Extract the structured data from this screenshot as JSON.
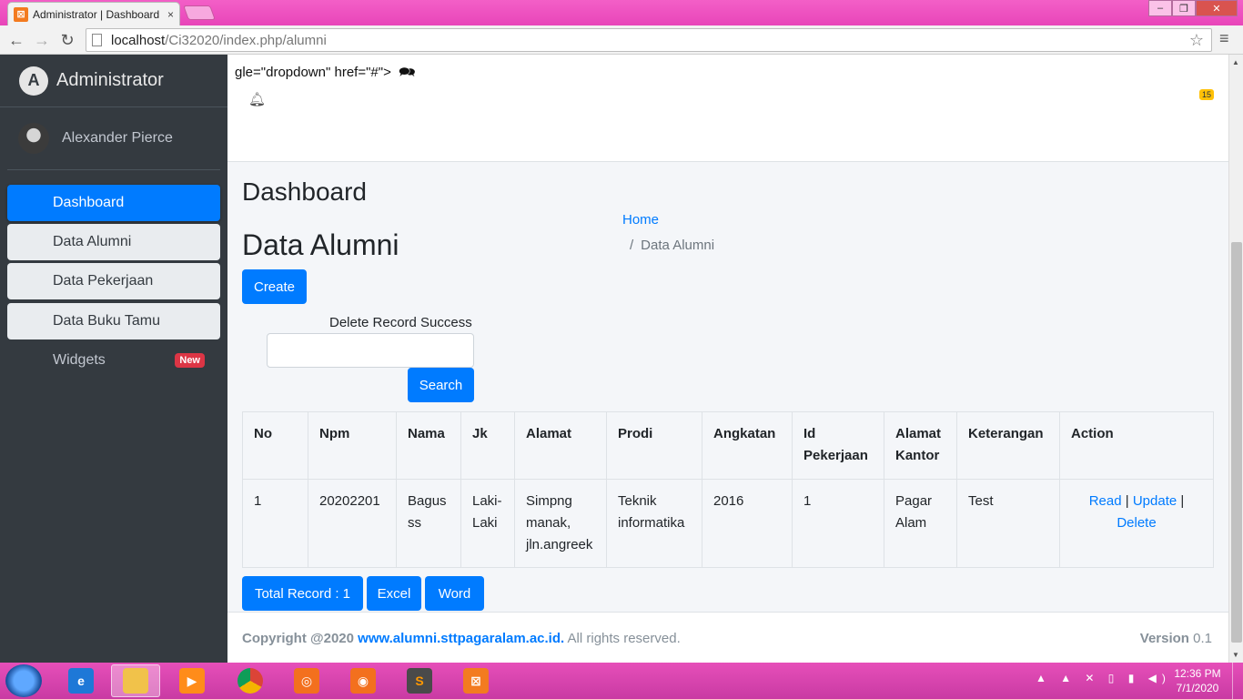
{
  "browser": {
    "tab_title": "Administrator | Dashboard",
    "tab_close": "×",
    "url_host": "localhost",
    "url_path": "/Ci32020/index.php/alumni",
    "window_controls": {
      "minimize": "–",
      "maximize": "❐",
      "close": "✕"
    }
  },
  "sidebar": {
    "brand": "Administrator",
    "brand_logo_letter": "A",
    "user": "Alexander Pierce",
    "items": [
      {
        "label": "Dashboard",
        "state": "active"
      },
      {
        "label": "Data Alumni",
        "state": "light"
      },
      {
        "label": "Data Pekerjaan",
        "state": "light"
      },
      {
        "label": "Data Buku Tamu",
        "state": "light"
      },
      {
        "label": "Widgets",
        "state": "plain",
        "badge": "New"
      }
    ]
  },
  "topnav": {
    "leaked_text": "gle=\"dropdown\" href=\"#\">",
    "notification_count": "15"
  },
  "content": {
    "header_title": "Dashboard",
    "breadcrumb": {
      "home": "Home",
      "separator": "/",
      "current": "Data Alumni"
    },
    "page_title": "Data Alumni",
    "create_label": "Create",
    "flash_message": "Delete Record Success",
    "search_value": "",
    "search_label": "Search",
    "table": {
      "headers": [
        "No",
        "Npm",
        "Nama",
        "Jk",
        "Alamat",
        "Prodi",
        "Angkatan",
        "Id Pekerjaan",
        "Alamat Kantor",
        "Keterangan",
        "Action"
      ],
      "rows": [
        {
          "no": "1",
          "npm": "20202201",
          "nama": "Bagus ss",
          "jk": "Laki-Laki",
          "alamat": "Simpng manak, jln.angreek",
          "prodi": "Teknik informatika",
          "angkatan": "2016",
          "id_pekerjaan": "1",
          "alamat_kantor": "Pagar Alam",
          "keterangan": "Test",
          "actions": {
            "read": "Read",
            "update": "Update",
            "delete": "Delete",
            "sep": "|"
          }
        }
      ]
    },
    "total_label": "Total Record : 1",
    "excel_label": "Excel",
    "word_label": "Word"
  },
  "footer": {
    "copyright_prefix": "Copyright @2020",
    "site": "www.alumni.sttpagaralam.ac.id.",
    "rights": "All rights reserved.",
    "version_label": "Version",
    "version_value": "0.1"
  },
  "taskbar": {
    "time": "12:36 PM",
    "date": "7/1/2020"
  },
  "colors": {
    "primary": "#007bff",
    "sidebar_bg": "#343a40",
    "content_bg": "#f4f6f9",
    "danger": "#dc3545",
    "warning": "#ffc107",
    "desktop_pink": "#e845b9"
  }
}
